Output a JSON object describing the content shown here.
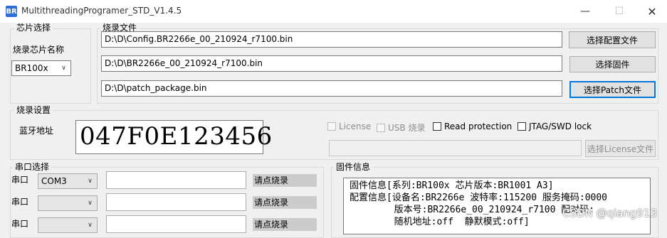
{
  "window": {
    "title": "MultithreadingProgramer_STD_V1.4.5",
    "icon_text": "BR"
  },
  "chip_group": {
    "title": "芯片选择",
    "label": "烧录芯片名称",
    "selected": "BR100x"
  },
  "files_group": {
    "title": "烧录文件",
    "rows": [
      {
        "path": "D:\\D\\Config.BR2266e_00_210924_r7100.bin",
        "button": "选择配置文件"
      },
      {
        "path": "D:\\D\\BR2266e_00_210924_r7100.bin",
        "button": "选择固件"
      },
      {
        "path": "D:\\D\\patch_package.bin",
        "button": "选择Patch文件"
      }
    ]
  },
  "settings_group": {
    "title": "烧录设置",
    "bt_label": "蓝牙地址",
    "bt_address": "047F0E123456",
    "license_label": "License",
    "usb_label": "USB 烧录",
    "read_protection_label": "Read protection",
    "jtag_label": "JTAG/SWD lock",
    "license_button": "选择License文件"
  },
  "serial_group": {
    "title": "串口选择",
    "rows": [
      {
        "label": "串口",
        "port": "COM3",
        "status": "请点烧录"
      },
      {
        "label": "串口",
        "port": "",
        "status": "请点烧录"
      },
      {
        "label": "串口",
        "port": "",
        "status": "请点烧录"
      }
    ]
  },
  "firmware_group": {
    "title": "固件信息",
    "lines": [
      "固件信息[系列:BR100x 芯片版本:BR1001 A3]",
      "配置信息[设备名:BR2266e 波特率:115200 服务掩码:0000",
      "        版本号:BR2266e_00_210924_r7100 配对码:",
      "        随机地址:off  静默模式:off]"
    ]
  },
  "watermark": "CSDN @qiang913"
}
